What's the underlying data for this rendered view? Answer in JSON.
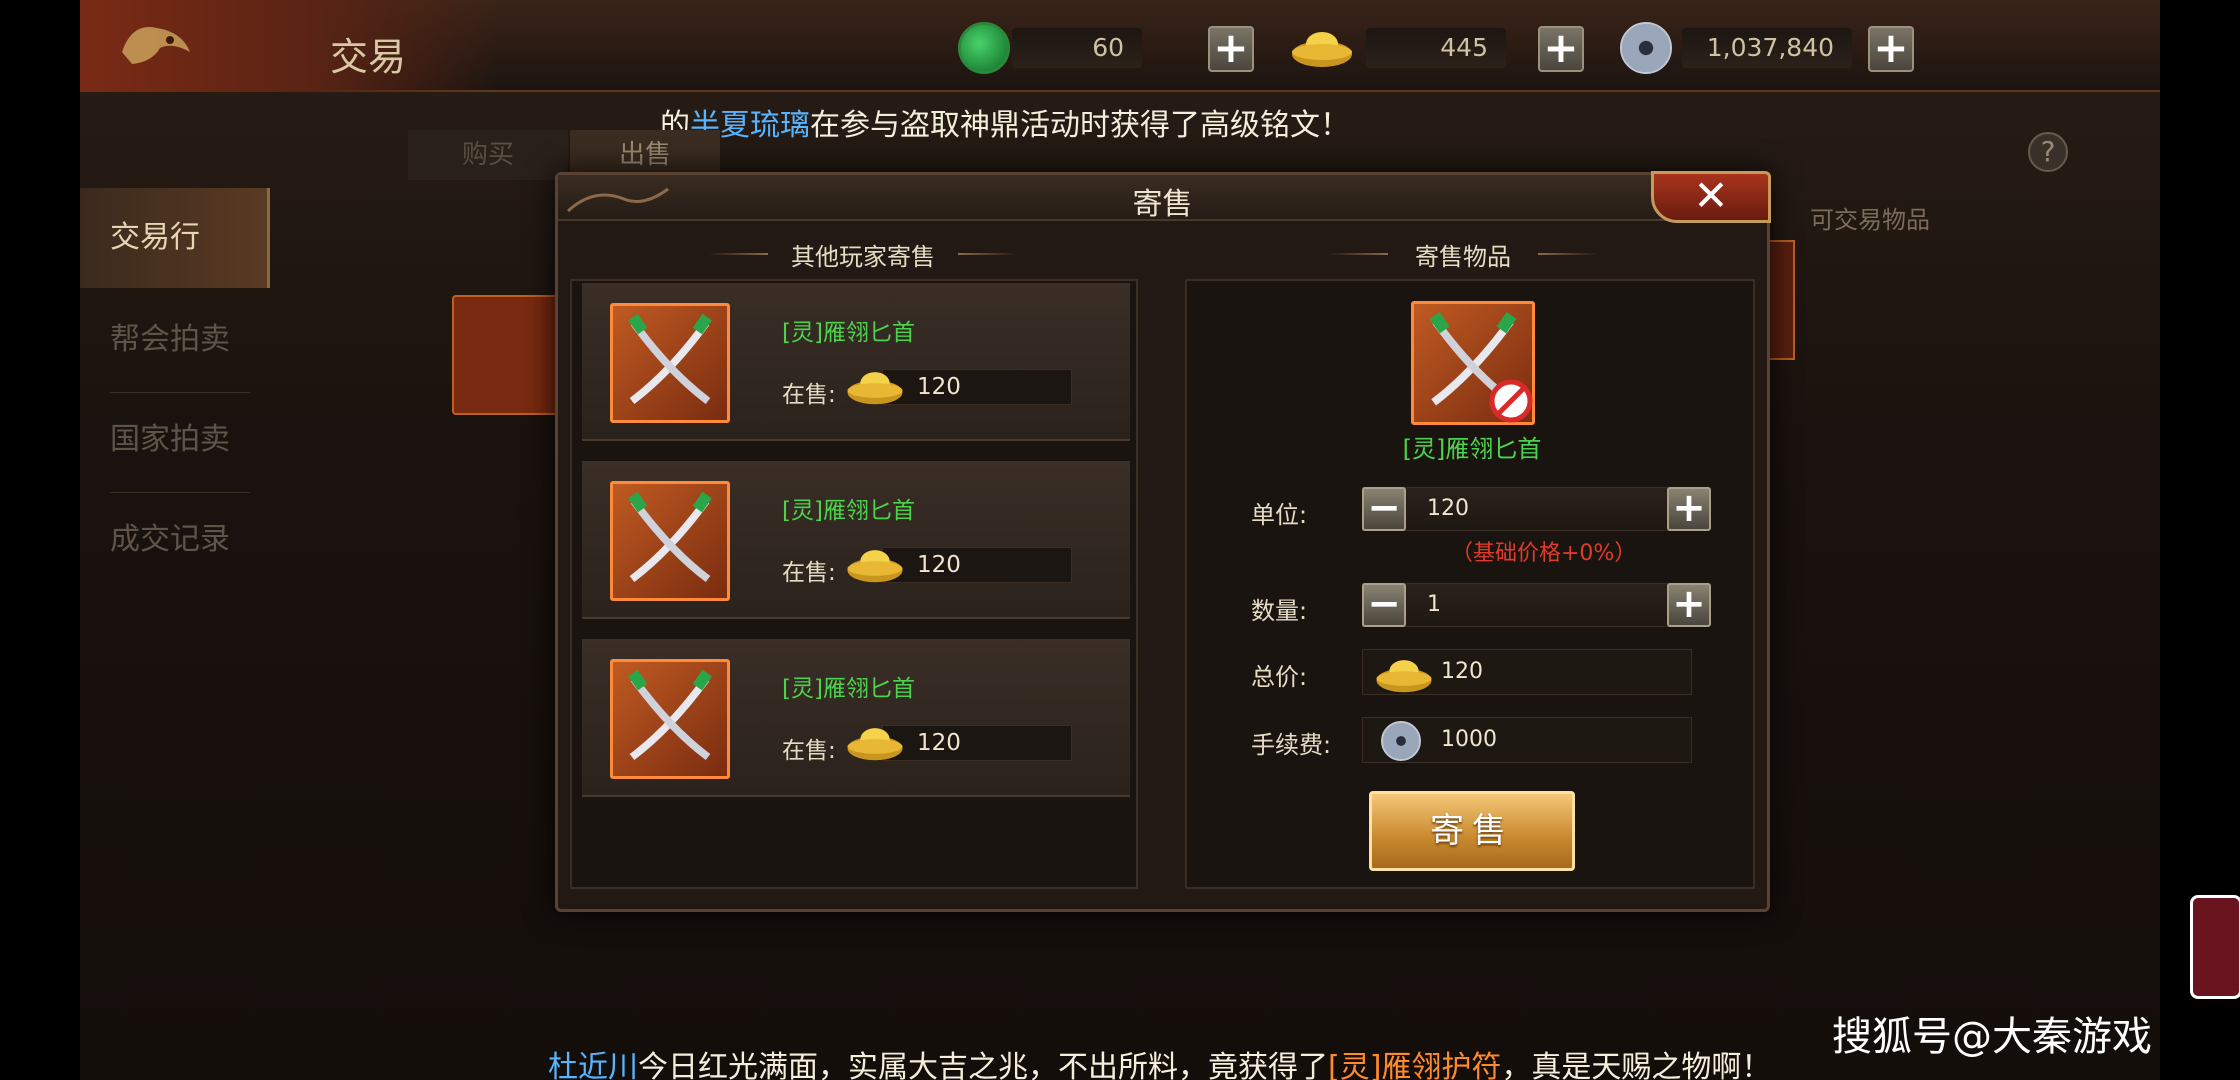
{
  "header": {
    "title": "交易",
    "resources": [
      {
        "icon": "jade-icon",
        "value": "60"
      },
      {
        "icon": "gold-ingot-icon",
        "value": "445"
      },
      {
        "icon": "silver-coin-icon",
        "value": "1,037,840"
      }
    ],
    "plus_label": "+"
  },
  "marquee_top": {
    "prefix": "的",
    "player": "半夏琉璃",
    "text": "在参与盗取神鼎活动时获得了高级铭文！"
  },
  "side_nav": [
    {
      "label": "交易行",
      "active": true
    },
    {
      "label": "帮会拍卖",
      "active": false
    },
    {
      "label": "国家拍卖",
      "active": false
    },
    {
      "label": "成交记录",
      "active": false
    }
  ],
  "tabs": {
    "buy": "购买",
    "sell": "出售"
  },
  "help_label": "?",
  "tradable_label": "可交易物品",
  "modal": {
    "title": "寄售",
    "close_label": "✕",
    "left_title": "其他玩家寄售",
    "right_title": "寄售物品",
    "listings": [
      {
        "name": "[灵]雁翎匕首",
        "sale_label": "在售:",
        "price": "120"
      },
      {
        "name": "[灵]雁翎匕首",
        "sale_label": "在售:",
        "price": "120"
      },
      {
        "name": "[灵]雁翎匕首",
        "sale_label": "在售:",
        "price": "120"
      }
    ],
    "item_name": "[灵]雁翎匕首",
    "unit_label": "单位:",
    "unit_value": "120",
    "base_price_note": "（基础价格+0%）",
    "quantity_label": "数量:",
    "quantity_value": "1",
    "total_label": "总价:",
    "total_value": "120",
    "fee_label": "手续费:",
    "fee_value": "1000",
    "minus_label": "−",
    "plus_label": "+",
    "sell_button": "寄售"
  },
  "marquee_bottom": {
    "player": "杜近川",
    "text1": "今日红光满面，实属大吉之兆，不出所料，竟获得了",
    "item": "[灵]雁翎护符",
    "text2": "，真是天赐之物啊！"
  },
  "watermark": "搜狐号@大秦游戏",
  "colors": {
    "item_green": "#4cd24c",
    "item_frame_orange": "#ff8a3a",
    "note_red": "#e03a2a",
    "player_blue": "#58b4ff"
  }
}
